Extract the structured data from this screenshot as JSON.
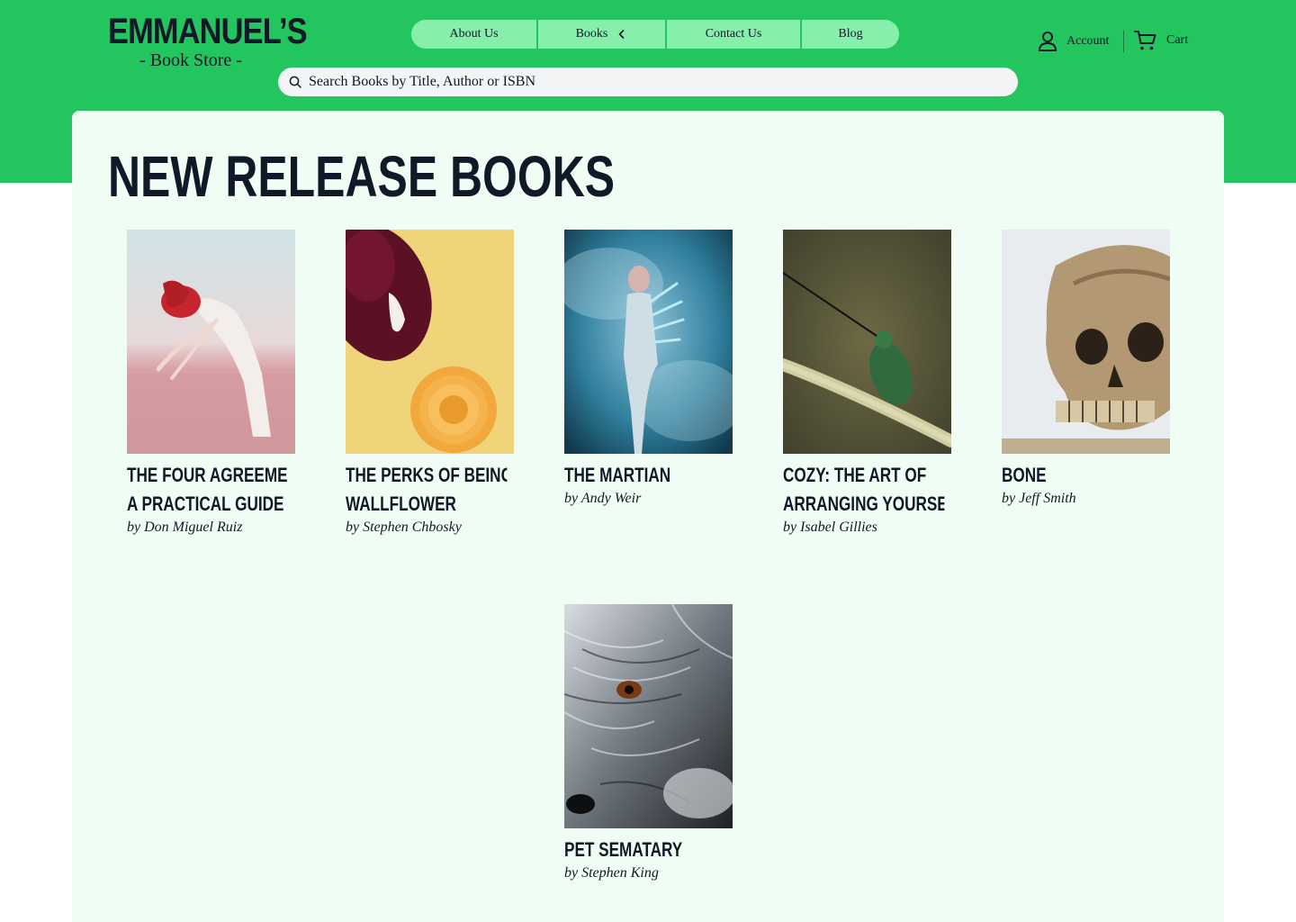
{
  "brand": {
    "name": "EMMANUEL’S",
    "tagline": "- Book Store -"
  },
  "nav": {
    "about": "About Us",
    "books": "Books",
    "contact": "Contact Us",
    "blog": "Blog"
  },
  "header": {
    "account_label": "Account",
    "cart_label": "Cart"
  },
  "search": {
    "placeholder": "Search Books by Title, Author or ISBN"
  },
  "section": {
    "title": "NEW RELEASE BOOKS"
  },
  "books": [
    {
      "title_line1": "THE FOUR AGREEMENTS:",
      "title_line2": "A PRACTICAL GUIDE TO…",
      "author": "by Don Miguel Ruiz"
    },
    {
      "title_line1": "THE PERKS OF BEING A",
      "title_line2": "WALLFLOWER",
      "author": "by Stephen Chbosky"
    },
    {
      "title_line1": "THE MARTIAN",
      "title_line2": "",
      "author": "by Andy Weir"
    },
    {
      "title_line1": "COZY: THE ART OF",
      "title_line2": "ARRANGING YOURSELF …",
      "author": "by Isabel Gillies"
    },
    {
      "title_line1": "BONE",
      "title_line2": "",
      "author": "by Jeff Smith"
    },
    {
      "title_line1": "PET SEMATARY",
      "title_line2": "",
      "author": "by Stephen King"
    }
  ],
  "colors": {
    "brand_green": "#22c55e",
    "nav_green": "#86efac",
    "panel_bg": "#f0fdf4",
    "text": "#111827"
  }
}
